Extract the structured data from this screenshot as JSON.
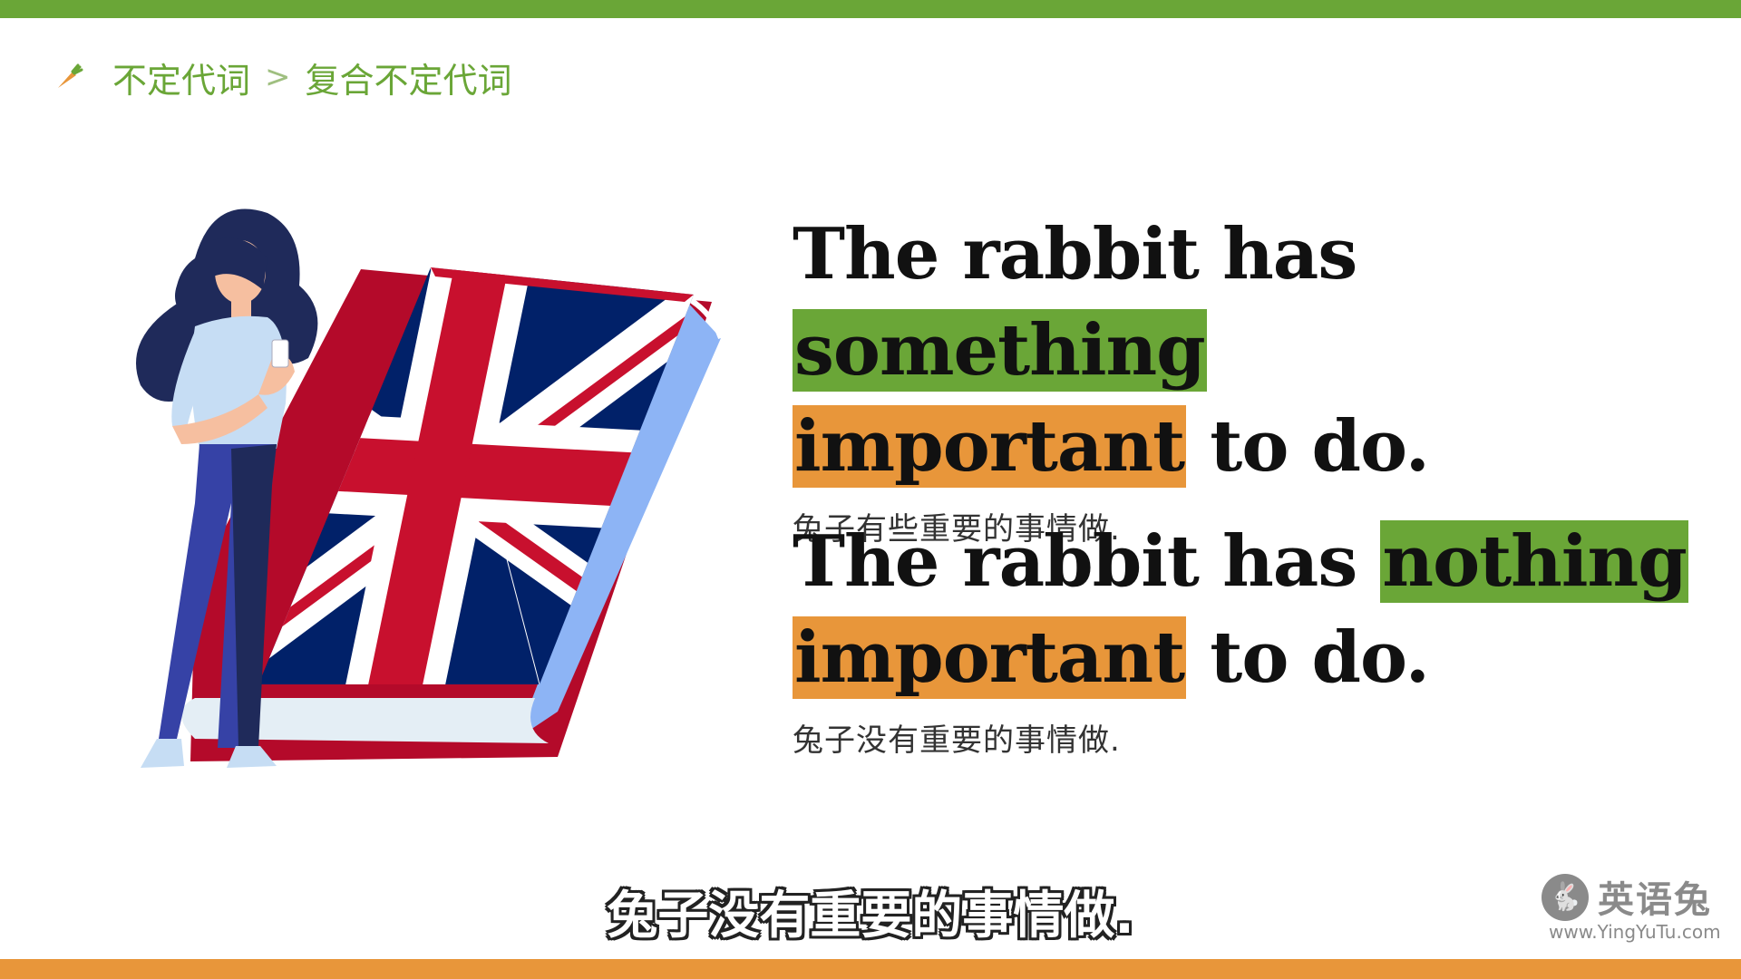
{
  "breadcrumb": {
    "parent": "不定代词",
    "separator": ">",
    "current": "复合不定代词"
  },
  "examples": [
    {
      "prefix": "The rabbit has ",
      "highlight_green": "something",
      "highlight_orange": "important",
      "suffix": " to do.",
      "translation": "兔子有些重要的事情做."
    },
    {
      "prefix": "The rabbit has ",
      "highlight_green": "nothing",
      "highlight_orange": "important",
      "suffix": " to do.",
      "translation": "兔子没有重要的事情做."
    }
  ],
  "subtitle": "兔子没有重要的事情做.",
  "logo": {
    "name": "英语兔",
    "url": "www.YingYuTu.com"
  },
  "colors": {
    "green": "#6aa637",
    "orange": "#e8963a",
    "flag_red": "#c8102e",
    "flag_blue": "#012169"
  }
}
